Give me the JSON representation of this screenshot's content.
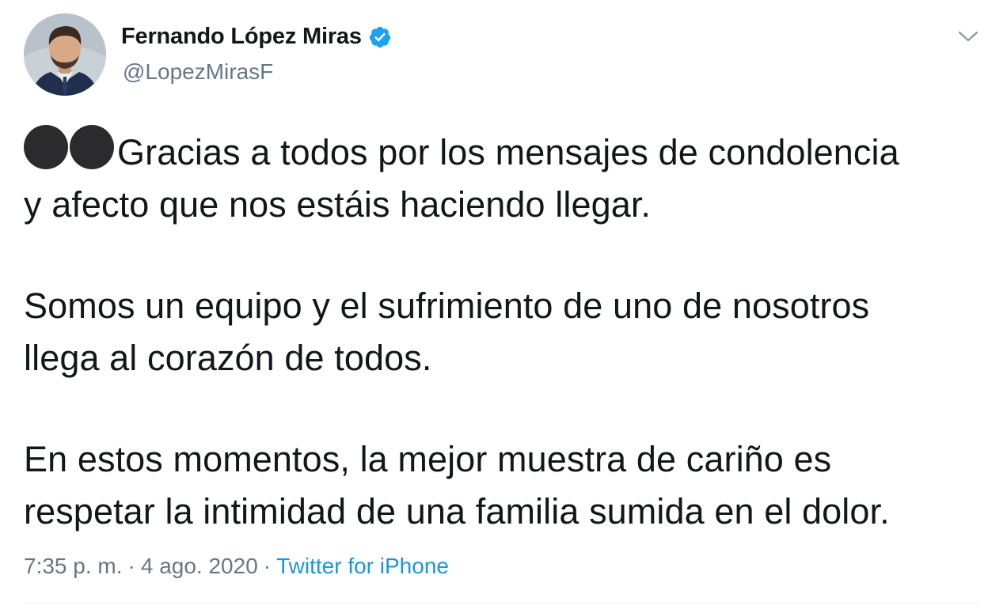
{
  "user": {
    "display_name": "Fernando López Miras",
    "handle": "@LopezMirasF",
    "verified": true
  },
  "tweet": {
    "emoji": [
      "black-circle",
      "black-circle"
    ],
    "paragraphs": [
      [
        "Gracias a todos por los mensajes de condolencia",
        "y afecto que nos estáis haciendo llegar."
      ],
      [
        "Somos un equipo y el sufrimiento de uno de nosotros",
        "llega al corazón de todos."
      ],
      [
        "En estos momentos, la mejor muestra de cariño es",
        "respetar la intimidad de una familia sumida en el dolor."
      ]
    ]
  },
  "meta": {
    "time": "7:35 p. m.",
    "separator": "·",
    "date": "4 ago. 2020",
    "source": "Twitter for iPhone"
  },
  "colors": {
    "verified_badge": "#1da1f2",
    "link": "#1b95e0",
    "secondary_text": "#657786"
  },
  "icons": {
    "verified": "verified-badge-icon",
    "menu": "chevron-down-icon"
  }
}
